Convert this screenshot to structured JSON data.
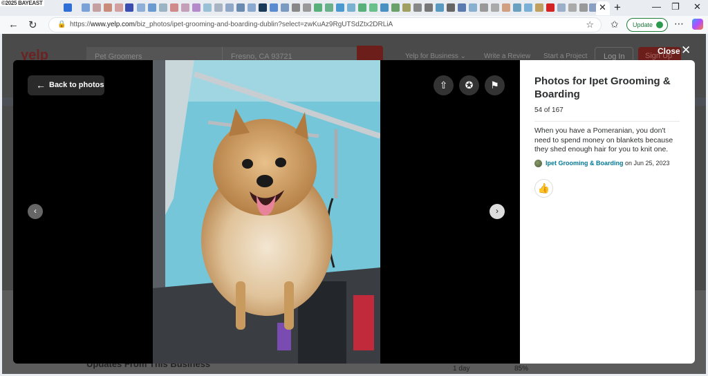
{
  "browser": {
    "watermark": "©2025 BAYEAST",
    "url_prefix": "https://",
    "url_domain": "www.yelp.com",
    "url_path": "/biz_photos/ipet-grooming-and-boarding-dublin?select=zwKuAz9RgUTSdZtx2DRLiA",
    "update_label": "Update",
    "tab_close": "✕",
    "new_tab": "+",
    "minimize": "—",
    "restore": "❐",
    "window_close": "✕"
  },
  "background_page": {
    "logo": "yelp",
    "search_placeholder": "Pet Groomers",
    "location_placeholder": "Fresno, CA 93721",
    "links": [
      "Yelp for Business ⌄",
      "Write a Review",
      "Start a Project"
    ],
    "login": "Log In",
    "signup": "Sign Up",
    "section_heading": "Updates From This Business",
    "stat_1": "1 day",
    "stat_2": "85%"
  },
  "overlay": {
    "close_label": "Close",
    "close_icon": "✕",
    "back_label": "Back to photos",
    "back_icon": "←",
    "prev_icon": "‹",
    "next_icon": "›",
    "share_icon": "⇧",
    "award_icon": "✪",
    "flag_icon": "⚑"
  },
  "panel": {
    "title": "Photos for Ipet Grooming & Boarding",
    "count": "54 of 167",
    "caption": "When you have a Pomeranian, you don't need to spend money on blankets because they shed enough hair for you to knit one.",
    "business_name": "Ipet Grooming & Boarding",
    "date_text": " on Jun 25, 2023",
    "like_icon": "👍"
  },
  "colors": {
    "yelp_red": "#d32323",
    "link_teal": "#027a97",
    "update_green": "#1b7b3a"
  }
}
